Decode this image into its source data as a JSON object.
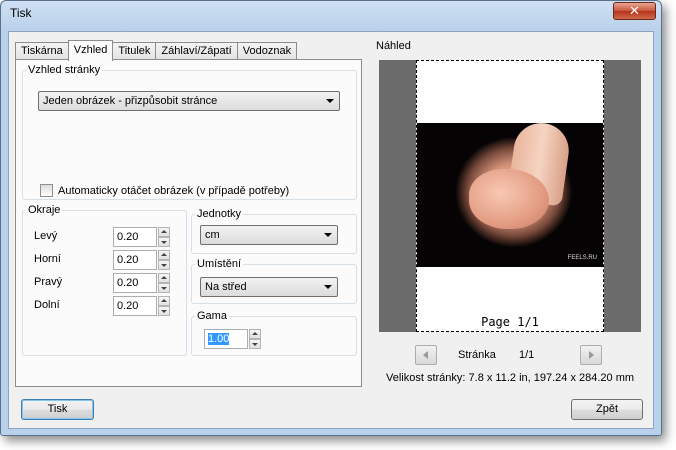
{
  "window": {
    "title": "Tisk",
    "close_glyph": "✕"
  },
  "tabs": [
    "Tiskárna",
    "Vzhled",
    "Titulek",
    "Záhlaví/Zápatí",
    "Vodoznak"
  ],
  "appearance": {
    "legend": "Vzhled stránky",
    "layout_value": "Jeden obrázek - přizpůsobit stránce",
    "auto_rotate_label": "Automaticky otáčet obrázek (v případě potřeby)",
    "auto_rotate_checked": false
  },
  "margins": {
    "legend": "Okraje",
    "left_label": "Levý",
    "left_value": "0.20",
    "top_label": "Horní",
    "top_value": "0.20",
    "right_label": "Pravý",
    "right_value": "0.20",
    "bottom_label": "Dolní",
    "bottom_value": "0.20"
  },
  "units": {
    "legend": "Jednotky",
    "value": "cm"
  },
  "placement": {
    "legend": "Umístění",
    "value": "Na střed"
  },
  "gamma": {
    "legend": "Gama",
    "value": "1.00"
  },
  "preview": {
    "legend": "Náhled",
    "page_label": "Page 1/1",
    "photo_watermark": "FEELS.RU",
    "page_caption": "Stránka",
    "page_count": "1/1",
    "page_size": "Velikost stránky: 7.8 x 11.2 in, 197.24 x 284.20 mm"
  },
  "buttons": {
    "print": "Tisk",
    "back": "Zpět"
  }
}
